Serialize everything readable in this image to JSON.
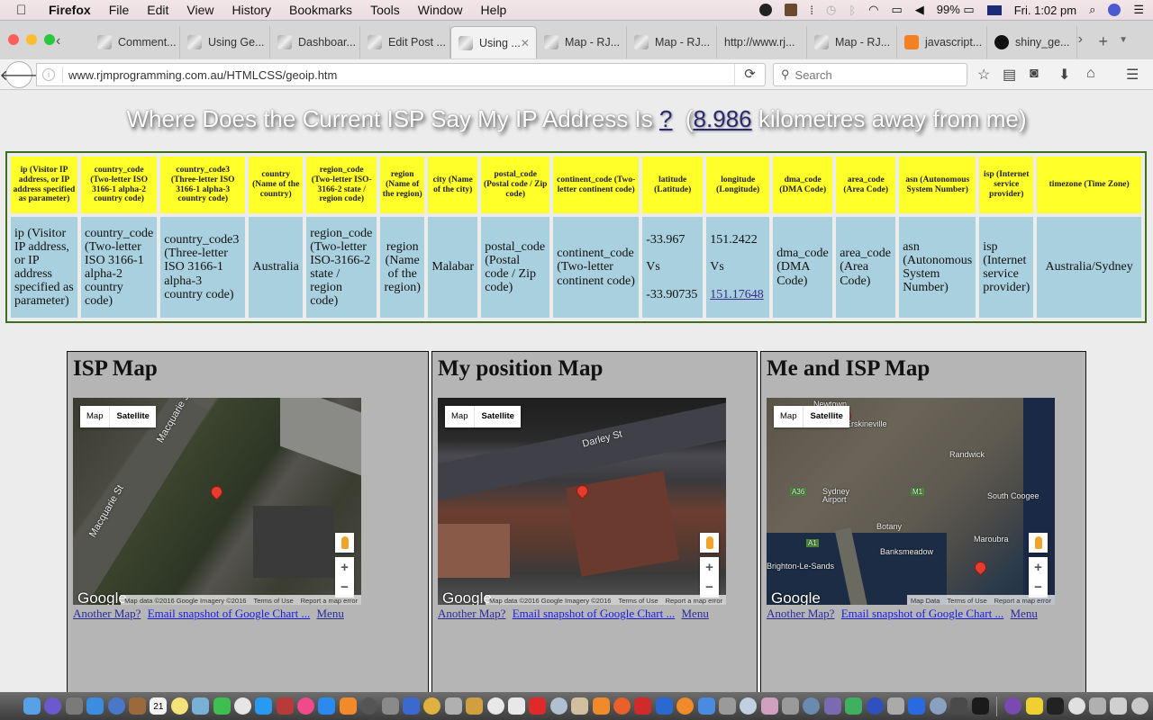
{
  "menubar": {
    "apple": "",
    "app_name": "Firefox",
    "items": [
      "File",
      "Edit",
      "View",
      "History",
      "Bookmarks",
      "Tools",
      "Window",
      "Help"
    ],
    "battery": "99%",
    "clock": "Fri. 1:02 pm"
  },
  "tabs": [
    {
      "label": "Comment...",
      "active": false
    },
    {
      "label": "Using Ge...",
      "active": false
    },
    {
      "label": "Dashboar...",
      "active": false
    },
    {
      "label": "Edit Post ...",
      "active": false
    },
    {
      "label": "Using ...",
      "active": true
    },
    {
      "label": "Map - RJ...",
      "active": false
    },
    {
      "label": "Map - RJ...",
      "active": false
    },
    {
      "label": "http://www.rj...",
      "active": false
    },
    {
      "label": "Map - RJ...",
      "active": false
    },
    {
      "label": "javascript...",
      "active": false
    },
    {
      "label": "shiny_ge...",
      "active": false
    }
  ],
  "navbar": {
    "url": "www.rjmprogramming.com.au/HTMLCSS/geoip.htm",
    "search_placeholder": "Search"
  },
  "page": {
    "title_prefix": "Where Does the Current ISP Say My IP Address Is ",
    "title_link": "?",
    "title_mid": "  (",
    "distance": "8.986",
    "title_suffix": " kilometres away from me)",
    "table": {
      "headers": [
        "ip (Visitor IP address, or IP address specified as parameter)",
        "country_code (Two-letter ISO 3166-1 alpha-2 country code)",
        "country_code3 (Three-letter ISO 3166-1 alpha-3 country code)",
        "country (Name of the country)",
        "region_code (Two-letter ISO-3166-2 state / region code)",
        "region (Name of the region)",
        "city (Name of the city)",
        "postal_code (Postal code / Zip code)",
        "continent_code (Two-letter continent code)",
        "latitude (Latitude)",
        "longitude (Longitude)",
        "dma_code (DMA Code)",
        "area_code (Area Code)",
        "asn (Autonomous System Number)",
        "isp (Internet service provider)",
        "timezone (Time Zone)"
      ],
      "row": {
        "ip": "ip (Visitor IP address, or IP address specified as parameter)",
        "country_code": "country_code (Two-letter ISO 3166-1 alpha-2 country code)",
        "country_code3": "country_code3 (Three-letter ISO 3166-1 alpha-3 country code)",
        "country": "Australia",
        "region_code": "region_code (Two-letter ISO-3166-2 state / region code)",
        "region": "region (Name of the region)",
        "city": "Malabar",
        "postal_code": "postal_code (Postal code / Zip code)",
        "continent_code": "continent_code (Two-letter continent code)",
        "latitude_isp": "-33.967",
        "latitude_vs": "Vs",
        "latitude_me": "-33.90735",
        "longitude_isp": "151.2422",
        "longitude_vs": "Vs",
        "longitude_me": "151.17648",
        "dma_code": "dma_code (DMA Code)",
        "area_code": "area_code (Area Code)",
        "asn": "asn (Autonomous System Number)",
        "isp": "isp (Internet service provider)",
        "timezone": "Australia/Sydney"
      }
    },
    "panels": [
      {
        "title": "ISP Map",
        "map_type": [
          "Map",
          "Satellite"
        ],
        "street_labels": [
          "Macquarie St",
          "Macquarie St"
        ],
        "attribution": [
          "Map data ©2016 Google Imagery ©2016",
          "Terms of Use",
          "Report a map error"
        ],
        "links": [
          "Another Map?",
          "Email snapshot of Google Chart ...",
          "Menu"
        ]
      },
      {
        "title": "My position Map",
        "map_type": [
          "Map",
          "Satellite"
        ],
        "street_labels": [
          "Darley St"
        ],
        "attribution": [
          "Map data ©2016 Google Imagery ©2016",
          "Terms of Use",
          "Report a map error"
        ],
        "links": [
          "Another Map?",
          "Email snapshot of Google Chart ...",
          "Menu"
        ]
      },
      {
        "title": "Me and ISP Map",
        "map_type": [
          "Map",
          "Satellite"
        ],
        "street_labels": [
          "Newtown",
          "Erskineville",
          "Randwick",
          "Sydney Airport",
          "South Coogee",
          "Botany",
          "Maroubra",
          "Banksmeadow",
          "Brighton-Le-Sands",
          "M1",
          "A36",
          "A1"
        ],
        "attribution": [
          "Map Data",
          "Terms of Use",
          "Report a map error"
        ],
        "links": [
          "Another Map?",
          "Email snapshot of Google Chart ...",
          "Menu"
        ]
      }
    ],
    "google_logo": "Google",
    "zoom_in": "+",
    "zoom_out": "−"
  },
  "dock": {
    "calendar_day": "21",
    "colors": [
      "#5aa0e6",
      "#6a5acd",
      "#7a7a7a",
      "#3a8de0",
      "#4a78c8",
      "#9a6a3a",
      "#f2f2f2",
      "#f5e27a",
      "#7ab0d8",
      "#3ec050",
      "#e6e6e6",
      "#2a9af0",
      "#b83a3a",
      "#f04a8a",
      "#2a8af0",
      "#f08a2a",
      "#555555",
      "#8a8a8a",
      "#3a6ad0",
      "#e0b040",
      "#b0b0b0",
      "#d0a040",
      "#e8e8e8",
      "#e8e8e8",
      "#e02a2a",
      "#b0c0d0",
      "#d0c0a0",
      "#f08a2a",
      "#e8602a",
      "#d02a2a",
      "#2a6ad0",
      "#f08a2a",
      "#4a8ae0",
      "#9a9a9a",
      "#c0d0e0",
      "#d0a0c0",
      "#9a9a9a",
      "#6a8ab0",
      "#7a6ab0",
      "#40b060",
      "#3050c0",
      "#aaaaaa",
      "#2a6ae0",
      "#8aa0c0",
      "#4a4a4a",
      "#1a1a1a",
      "#7a4ab0",
      "#f0d030",
      "#222222",
      "#e0e0e0",
      "#b0b0b0",
      "#d0d0d0",
      "#c8c8c8"
    ]
  }
}
